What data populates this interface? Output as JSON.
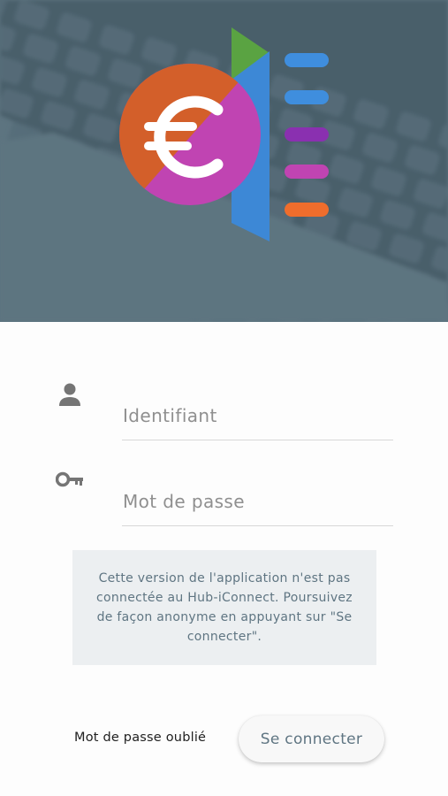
{
  "header": {
    "background_color": "#5d7480",
    "logo": {
      "icon": "euro-icon",
      "colors": {
        "circle_top": "#d35f2a",
        "circle_bottom": "#c044b2",
        "triangle": "#5aa342",
        "bar": "#3d88d6",
        "lines": [
          "#3f8ede",
          "#3f8ede",
          "#8a30b0",
          "#c044b2",
          "#ef6d2c"
        ]
      }
    }
  },
  "form": {
    "username": {
      "icon": "user-icon",
      "placeholder": "Identifiant",
      "value": ""
    },
    "password": {
      "icon": "key-icon",
      "placeholder": "Mot de passe",
      "value": ""
    },
    "notice": "Cette version de l'application n'est pas connectée au Hub-iConnect. Poursuivez de façon anonyme en appuyant sur \"Se connecter\".",
    "forgot_password_label": "Mot de passe oublié",
    "login_label": "Se connecter"
  }
}
